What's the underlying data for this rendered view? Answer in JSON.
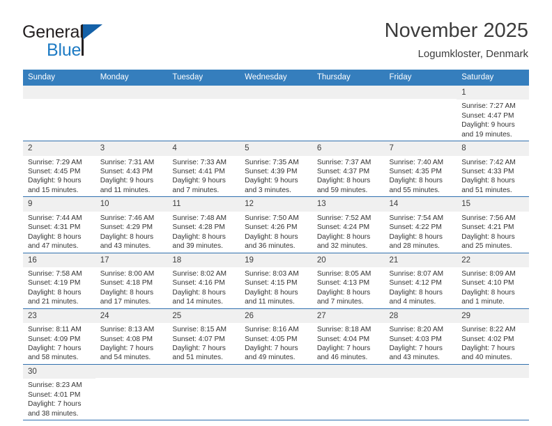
{
  "brand": {
    "name_part1": "General",
    "name_part2": "Blue",
    "triangle_color": "#1461a8",
    "blue_color": "#1e7bc4"
  },
  "header": {
    "month_title": "November 2025",
    "location": "Logumkloster, Denmark",
    "header_bg": "#357ebd",
    "daynum_bg": "#f0f0f0",
    "row_divider": "#2f6fae"
  },
  "weekday_headers": [
    "Sunday",
    "Monday",
    "Tuesday",
    "Wednesday",
    "Thursday",
    "Friday",
    "Saturday"
  ],
  "labels": {
    "sunrise": "Sunrise:",
    "sunset": "Sunset:",
    "daylight": "Daylight:"
  },
  "weeks": [
    [
      {
        "day": "",
        "empty": true
      },
      {
        "day": "",
        "empty": true
      },
      {
        "day": "",
        "empty": true
      },
      {
        "day": "",
        "empty": true
      },
      {
        "day": "",
        "empty": true
      },
      {
        "day": "",
        "empty": true
      },
      {
        "day": "1",
        "sunrise": "Sunrise: 7:27 AM",
        "sunset": "Sunset: 4:47 PM",
        "daylight_line1": "Daylight: 9 hours",
        "daylight_line2": "and 19 minutes."
      }
    ],
    [
      {
        "day": "2",
        "sunrise": "Sunrise: 7:29 AM",
        "sunset": "Sunset: 4:45 PM",
        "daylight_line1": "Daylight: 9 hours",
        "daylight_line2": "and 15 minutes."
      },
      {
        "day": "3",
        "sunrise": "Sunrise: 7:31 AM",
        "sunset": "Sunset: 4:43 PM",
        "daylight_line1": "Daylight: 9 hours",
        "daylight_line2": "and 11 minutes."
      },
      {
        "day": "4",
        "sunrise": "Sunrise: 7:33 AM",
        "sunset": "Sunset: 4:41 PM",
        "daylight_line1": "Daylight: 9 hours",
        "daylight_line2": "and 7 minutes."
      },
      {
        "day": "5",
        "sunrise": "Sunrise: 7:35 AM",
        "sunset": "Sunset: 4:39 PM",
        "daylight_line1": "Daylight: 9 hours",
        "daylight_line2": "and 3 minutes."
      },
      {
        "day": "6",
        "sunrise": "Sunrise: 7:37 AM",
        "sunset": "Sunset: 4:37 PM",
        "daylight_line1": "Daylight: 8 hours",
        "daylight_line2": "and 59 minutes."
      },
      {
        "day": "7",
        "sunrise": "Sunrise: 7:40 AM",
        "sunset": "Sunset: 4:35 PM",
        "daylight_line1": "Daylight: 8 hours",
        "daylight_line2": "and 55 minutes."
      },
      {
        "day": "8",
        "sunrise": "Sunrise: 7:42 AM",
        "sunset": "Sunset: 4:33 PM",
        "daylight_line1": "Daylight: 8 hours",
        "daylight_line2": "and 51 minutes."
      }
    ],
    [
      {
        "day": "9",
        "sunrise": "Sunrise: 7:44 AM",
        "sunset": "Sunset: 4:31 PM",
        "daylight_line1": "Daylight: 8 hours",
        "daylight_line2": "and 47 minutes."
      },
      {
        "day": "10",
        "sunrise": "Sunrise: 7:46 AM",
        "sunset": "Sunset: 4:29 PM",
        "daylight_line1": "Daylight: 8 hours",
        "daylight_line2": "and 43 minutes."
      },
      {
        "day": "11",
        "sunrise": "Sunrise: 7:48 AM",
        "sunset": "Sunset: 4:28 PM",
        "daylight_line1": "Daylight: 8 hours",
        "daylight_line2": "and 39 minutes."
      },
      {
        "day": "12",
        "sunrise": "Sunrise: 7:50 AM",
        "sunset": "Sunset: 4:26 PM",
        "daylight_line1": "Daylight: 8 hours",
        "daylight_line2": "and 36 minutes."
      },
      {
        "day": "13",
        "sunrise": "Sunrise: 7:52 AM",
        "sunset": "Sunset: 4:24 PM",
        "daylight_line1": "Daylight: 8 hours",
        "daylight_line2": "and 32 minutes."
      },
      {
        "day": "14",
        "sunrise": "Sunrise: 7:54 AM",
        "sunset": "Sunset: 4:22 PM",
        "daylight_line1": "Daylight: 8 hours",
        "daylight_line2": "and 28 minutes."
      },
      {
        "day": "15",
        "sunrise": "Sunrise: 7:56 AM",
        "sunset": "Sunset: 4:21 PM",
        "daylight_line1": "Daylight: 8 hours",
        "daylight_line2": "and 25 minutes."
      }
    ],
    [
      {
        "day": "16",
        "sunrise": "Sunrise: 7:58 AM",
        "sunset": "Sunset: 4:19 PM",
        "daylight_line1": "Daylight: 8 hours",
        "daylight_line2": "and 21 minutes."
      },
      {
        "day": "17",
        "sunrise": "Sunrise: 8:00 AM",
        "sunset": "Sunset: 4:18 PM",
        "daylight_line1": "Daylight: 8 hours",
        "daylight_line2": "and 17 minutes."
      },
      {
        "day": "18",
        "sunrise": "Sunrise: 8:02 AM",
        "sunset": "Sunset: 4:16 PM",
        "daylight_line1": "Daylight: 8 hours",
        "daylight_line2": "and 14 minutes."
      },
      {
        "day": "19",
        "sunrise": "Sunrise: 8:03 AM",
        "sunset": "Sunset: 4:15 PM",
        "daylight_line1": "Daylight: 8 hours",
        "daylight_line2": "and 11 minutes."
      },
      {
        "day": "20",
        "sunrise": "Sunrise: 8:05 AM",
        "sunset": "Sunset: 4:13 PM",
        "daylight_line1": "Daylight: 8 hours",
        "daylight_line2": "and 7 minutes."
      },
      {
        "day": "21",
        "sunrise": "Sunrise: 8:07 AM",
        "sunset": "Sunset: 4:12 PM",
        "daylight_line1": "Daylight: 8 hours",
        "daylight_line2": "and 4 minutes."
      },
      {
        "day": "22",
        "sunrise": "Sunrise: 8:09 AM",
        "sunset": "Sunset: 4:10 PM",
        "daylight_line1": "Daylight: 8 hours",
        "daylight_line2": "and 1 minute."
      }
    ],
    [
      {
        "day": "23",
        "sunrise": "Sunrise: 8:11 AM",
        "sunset": "Sunset: 4:09 PM",
        "daylight_line1": "Daylight: 7 hours",
        "daylight_line2": "and 58 minutes."
      },
      {
        "day": "24",
        "sunrise": "Sunrise: 8:13 AM",
        "sunset": "Sunset: 4:08 PM",
        "daylight_line1": "Daylight: 7 hours",
        "daylight_line2": "and 54 minutes."
      },
      {
        "day": "25",
        "sunrise": "Sunrise: 8:15 AM",
        "sunset": "Sunset: 4:07 PM",
        "daylight_line1": "Daylight: 7 hours",
        "daylight_line2": "and 51 minutes."
      },
      {
        "day": "26",
        "sunrise": "Sunrise: 8:16 AM",
        "sunset": "Sunset: 4:05 PM",
        "daylight_line1": "Daylight: 7 hours",
        "daylight_line2": "and 49 minutes."
      },
      {
        "day": "27",
        "sunrise": "Sunrise: 8:18 AM",
        "sunset": "Sunset: 4:04 PM",
        "daylight_line1": "Daylight: 7 hours",
        "daylight_line2": "and 46 minutes."
      },
      {
        "day": "28",
        "sunrise": "Sunrise: 8:20 AM",
        "sunset": "Sunset: 4:03 PM",
        "daylight_line1": "Daylight: 7 hours",
        "daylight_line2": "and 43 minutes."
      },
      {
        "day": "29",
        "sunrise": "Sunrise: 8:22 AM",
        "sunset": "Sunset: 4:02 PM",
        "daylight_line1": "Daylight: 7 hours",
        "daylight_line2": "and 40 minutes."
      }
    ],
    [
      {
        "day": "30",
        "sunrise": "Sunrise: 8:23 AM",
        "sunset": "Sunset: 4:01 PM",
        "daylight_line1": "Daylight: 7 hours",
        "daylight_line2": "and 38 minutes."
      },
      {
        "day": "",
        "empty": true
      },
      {
        "day": "",
        "empty": true
      },
      {
        "day": "",
        "empty": true
      },
      {
        "day": "",
        "empty": true
      },
      {
        "day": "",
        "empty": true
      },
      {
        "day": "",
        "empty": true
      }
    ]
  ]
}
